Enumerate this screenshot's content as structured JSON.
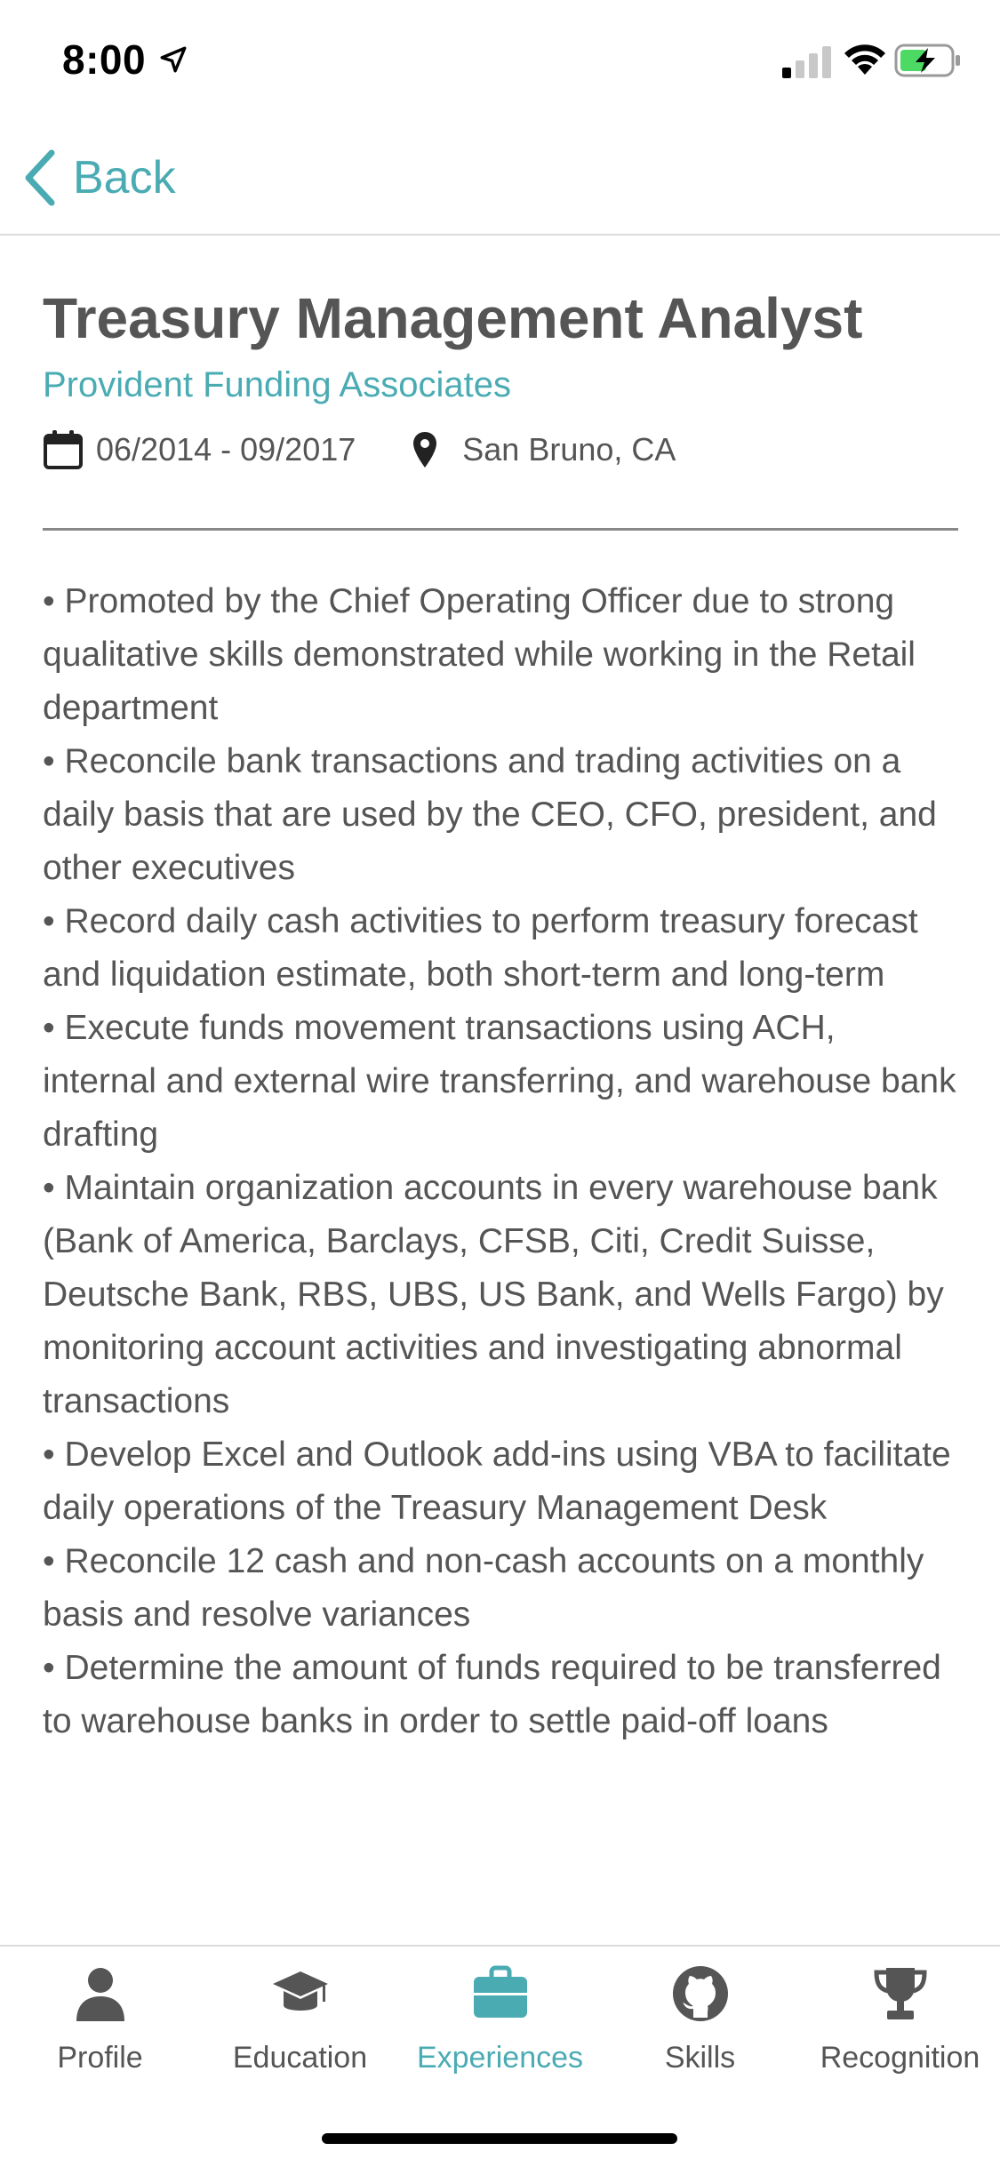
{
  "status": {
    "time": "8:00",
    "signal_bars": 4,
    "signal_active": 1,
    "battery_charging": true,
    "battery_level": 0.45
  },
  "nav": {
    "back_label": "Back"
  },
  "experience": {
    "title": "Treasury Management Analyst",
    "company": "Provident Funding Associates",
    "dates": "06/2014 - 09/2017",
    "location": "San Bruno, CA",
    "bullets": [
      "• Promoted by the Chief Operating Officer due to strong qualitative skills demonstrated while working in the Retail department",
      "• Reconcile bank transactions and trading activities on a daily basis that are used by the CEO, CFO, president, and other executives",
      "• Record daily cash activities to perform treasury forecast and liquidation estimate, both short-term and long-term",
      "• Execute funds movement transactions using ACH, internal and external wire transferring, and warehouse bank drafting",
      "• Maintain organization accounts in every warehouse bank (Bank of America, Barclays, CFSB, Citi, Credit Suisse, Deutsche Bank, RBS, UBS, US Bank, and Wells Fargo) by monitoring account activities and investigating abnormal transactions",
      "• Develop Excel and Outlook add-ins using VBA to facilitate daily operations of the Treasury Management Desk",
      "• Reconcile 12 cash and non-cash accounts on a monthly basis and resolve variances",
      "• Determine the amount of funds required to be transferred to warehouse banks in order to settle paid-off loans"
    ]
  },
  "tabs": [
    {
      "label": "Profile",
      "icon": "person-icon",
      "active": false
    },
    {
      "label": "Education",
      "icon": "graduation-cap-icon",
      "active": false
    },
    {
      "label": "Experiences",
      "icon": "briefcase-icon",
      "active": true
    },
    {
      "label": "Skills",
      "icon": "github-icon",
      "active": false
    },
    {
      "label": "Recognition",
      "icon": "trophy-icon",
      "active": false
    }
  ],
  "colors": {
    "accent": "#4aabb3",
    "text": "#555555",
    "divider": "#888888"
  }
}
